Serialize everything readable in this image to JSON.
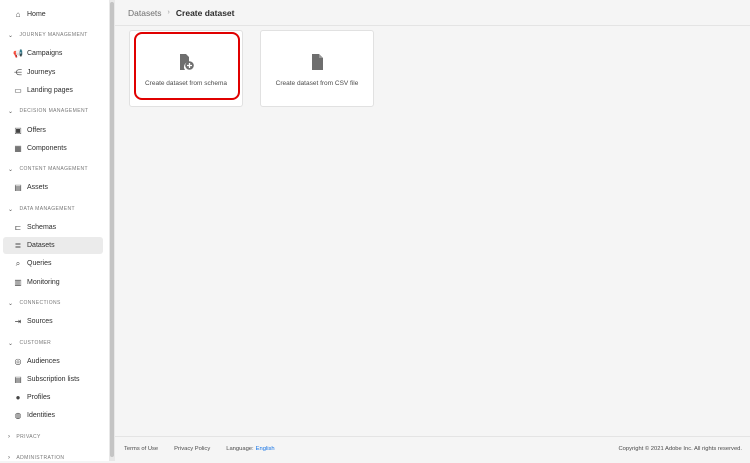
{
  "sidebar": {
    "home": "Home",
    "sections": [
      {
        "label": "JOURNEY MANAGEMENT",
        "items": [
          "Campaigns",
          "Journeys",
          "Landing pages"
        ]
      },
      {
        "label": "DECISION MANAGEMENT",
        "items": [
          "Offers",
          "Components"
        ]
      },
      {
        "label": "CONTENT MANAGEMENT",
        "items": [
          "Assets"
        ]
      },
      {
        "label": "DATA MANAGEMENT",
        "items": [
          "Schemas",
          "Datasets",
          "Queries",
          "Monitoring"
        ]
      },
      {
        "label": "CONNECTIONS",
        "items": [
          "Sources"
        ]
      },
      {
        "label": "CUSTOMER",
        "items": [
          "Audiences",
          "Subscription lists",
          "Profiles",
          "Identities"
        ]
      },
      {
        "label": "PRIVACY",
        "items": []
      },
      {
        "label": "ADMINISTRATION",
        "items": []
      }
    ],
    "selected": "Datasets"
  },
  "breadcrumb": {
    "parent": "Datasets",
    "current": "Create dataset"
  },
  "cards": [
    {
      "label": "Create dataset from schema",
      "icon": "file-add-icon",
      "highlighted": true
    },
    {
      "label": "Create dataset from CSV file",
      "icon": "file-icon"
    }
  ],
  "footer": {
    "terms": "Terms of Use",
    "privacy": "Privacy Policy",
    "language_label": "Language:",
    "language": "English",
    "copyright": "Copyright © 2021 Adobe Inc. All rights reserved."
  },
  "colors": {
    "highlight": "#e00000",
    "link": "#1473e6"
  }
}
